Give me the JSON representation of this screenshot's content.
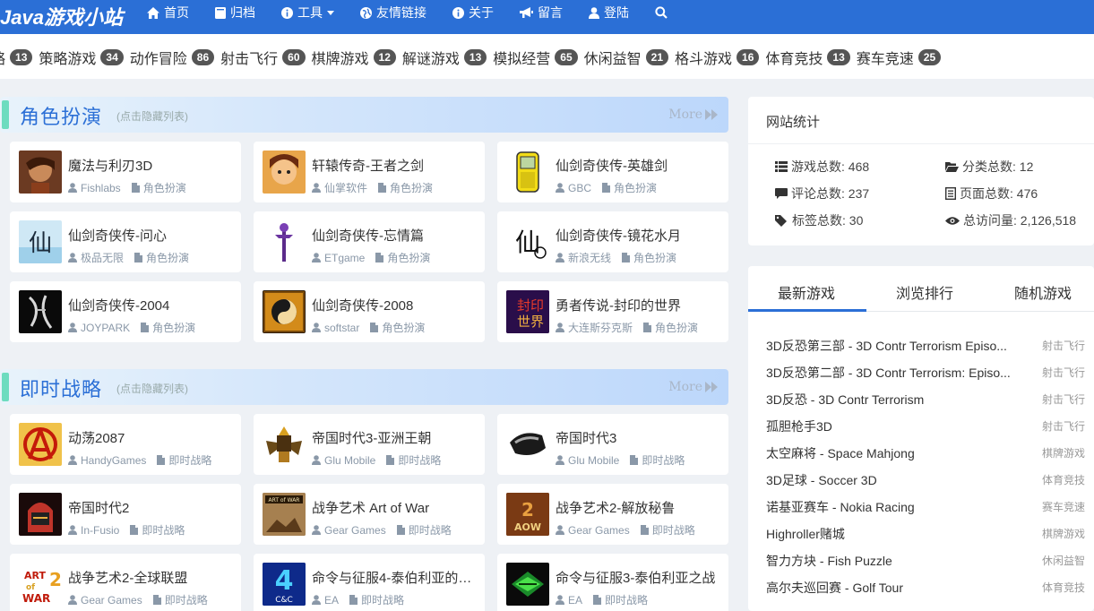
{
  "header": {
    "logo": "Java游戏小站",
    "nav": [
      {
        "label": "首页",
        "icon": "home-icon"
      },
      {
        "label": "归档",
        "icon": "book-icon"
      },
      {
        "label": "工具",
        "icon": "info-circle-icon",
        "dropdown": true
      },
      {
        "label": "友情链接",
        "icon": "globe-icon"
      },
      {
        "label": "关于",
        "icon": "info-circle-icon"
      },
      {
        "label": "留言",
        "icon": "bullhorn-icon"
      },
      {
        "label": "登陆",
        "icon": "user-icon"
      }
    ],
    "search_icon": "search-icon",
    "bg_color": "#2b6fd6"
  },
  "categories": [
    {
      "label": "略",
      "count": "13"
    },
    {
      "label": "策略游戏",
      "count": "34"
    },
    {
      "label": "动作冒险",
      "count": "86"
    },
    {
      "label": "射击飞行",
      "count": "60"
    },
    {
      "label": "棋牌游戏",
      "count": "12"
    },
    {
      "label": "解谜游戏",
      "count": "13"
    },
    {
      "label": "模拟经营",
      "count": "65"
    },
    {
      "label": "休闲益智",
      "count": "21"
    },
    {
      "label": "格斗游戏",
      "count": "16"
    },
    {
      "label": "体育竞技",
      "count": "13"
    },
    {
      "label": "赛车竞速",
      "count": "25"
    }
  ],
  "sections": [
    {
      "title": "角色扮演",
      "hint": "(点击隐藏列表)",
      "more": "More",
      "games": [
        {
          "name": "魔法与利刃3D",
          "vendor": "Fishlabs",
          "category": "角色扮演"
        },
        {
          "name": "轩辕传奇-王者之剑",
          "vendor": "仙掌软件",
          "category": "角色扮演"
        },
        {
          "name": "仙剑奇侠传-英雄剑",
          "vendor": "GBC",
          "category": "角色扮演"
        },
        {
          "name": "仙剑奇侠传-问心",
          "vendor": "极品无限",
          "category": "角色扮演"
        },
        {
          "name": "仙剑奇侠传-忘情篇",
          "vendor": "ETgame",
          "category": "角色扮演"
        },
        {
          "name": "仙剑奇侠传-镜花水月",
          "vendor": "新浪无线",
          "category": "角色扮演"
        },
        {
          "name": "仙剑奇侠传-2004",
          "vendor": "JOYPARK",
          "category": "角色扮演"
        },
        {
          "name": "仙剑奇侠传-2008",
          "vendor": "softstar",
          "category": "角色扮演"
        },
        {
          "name": "勇者传说-封印的世界",
          "vendor": "大连斯芬克斯",
          "category": "角色扮演"
        }
      ]
    },
    {
      "title": "即时战略",
      "hint": "(点击隐藏列表)",
      "more": "More",
      "games": [
        {
          "name": "动荡2087",
          "vendor": "HandyGames",
          "category": "即时战略"
        },
        {
          "name": "帝国时代3-亚洲王朝",
          "vendor": "Glu Mobile",
          "category": "即时战略"
        },
        {
          "name": "帝国时代3",
          "vendor": "Glu Mobile",
          "category": "即时战略"
        },
        {
          "name": "帝国时代2",
          "vendor": "In-Fusio",
          "category": "即时战略"
        },
        {
          "name": "战争艺术 Art of War",
          "vendor": "Gear Games",
          "category": "即时战略"
        },
        {
          "name": "战争艺术2-解放秘鲁",
          "vendor": "Gear Games",
          "category": "即时战略"
        },
        {
          "name": "战争艺术2-全球联盟",
          "vendor": "Gear Games",
          "category": "即时战略"
        },
        {
          "name": "命令与征服4-泰伯利亚的…",
          "vendor": "EA",
          "category": "即时战略"
        },
        {
          "name": "命令与征服3-泰伯利亚之战",
          "vendor": "EA",
          "category": "即时战略"
        }
      ]
    }
  ],
  "stats": {
    "title": "网站统计",
    "items": [
      {
        "label": "游戏总数: 468",
        "icon": "list-icon"
      },
      {
        "label": "分类总数: 12",
        "icon": "folder-open-icon"
      },
      {
        "label": "评论总数: 237",
        "icon": "comment-icon"
      },
      {
        "label": "页面总数: 476",
        "icon": "file-text-icon"
      },
      {
        "label": "标签总数: 30",
        "icon": "tags-icon"
      },
      {
        "label": "总访问量: 2,126,518",
        "icon": "eye-icon"
      }
    ]
  },
  "tabs": [
    "最新游戏",
    "浏览排行",
    "随机游戏"
  ],
  "latest": [
    {
      "name": "3D反恐第三部 - 3D Contr Terrorism Episo...",
      "category": "射击飞行"
    },
    {
      "name": "3D反恐第二部 - 3D Contr Terrorism: Episo...",
      "category": "射击飞行"
    },
    {
      "name": "3D反恐 - 3D Contr Terrorism",
      "category": "射击飞行"
    },
    {
      "name": "孤胆枪手3D",
      "category": "射击飞行"
    },
    {
      "name": "太空麻将 - Space Mahjong",
      "category": "棋牌游戏"
    },
    {
      "name": "3D足球 - Soccer 3D",
      "category": "体育竞技"
    },
    {
      "name": "诺基亚赛车 - Nokia Racing",
      "category": "赛车竞速"
    },
    {
      "name": "Highroller赌城",
      "category": "棋牌游戏"
    },
    {
      "name": "智力方块 - Fish Puzzle",
      "category": "休闲益智"
    },
    {
      "name": "高尔夫巡回赛 - Golf Tour",
      "category": "体育竞技"
    }
  ]
}
